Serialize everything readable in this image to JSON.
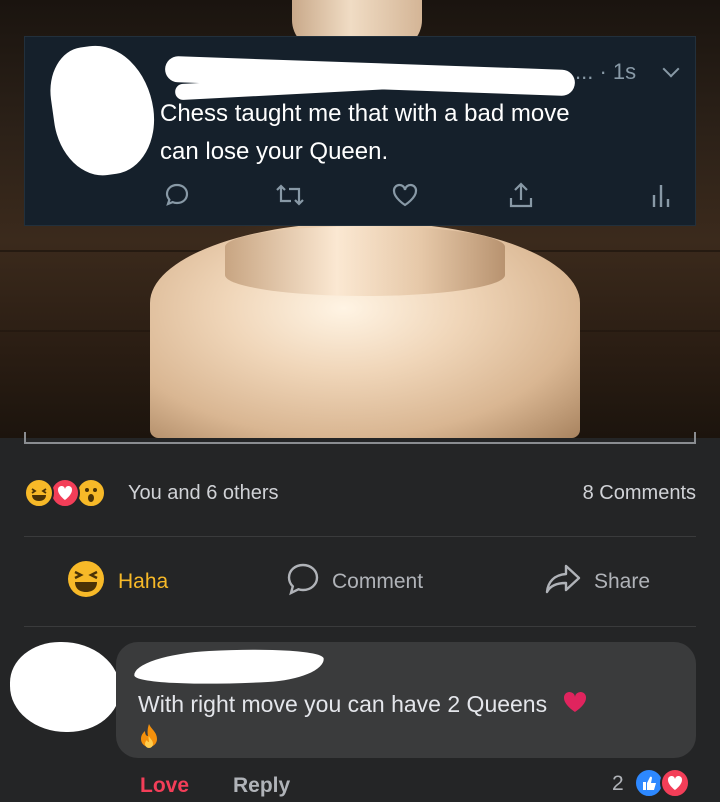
{
  "tweet": {
    "meta": "... · 1s",
    "text_line1": "Chess taught me that with a bad move",
    "text_line2": "can lose your Queen."
  },
  "post": {
    "reactions_summary": "You and 6 others",
    "comments_count": "8 Comments",
    "reaction_icons": [
      "haha-icon",
      "love-icon",
      "wow-icon"
    ]
  },
  "actions": {
    "haha_label": "Haha",
    "comment_label": "Comment",
    "share_label": "Share"
  },
  "comment": {
    "text": "With right move you can have 2 Queens",
    "love_label": "Love",
    "reply_label": "Reply",
    "reaction_count": "2"
  },
  "colors": {
    "background": "#242526",
    "tweet_bg": "#15202b",
    "love_red": "#f33e58",
    "haha_yellow": "#f7b928",
    "like_blue": "#2d88ff"
  }
}
